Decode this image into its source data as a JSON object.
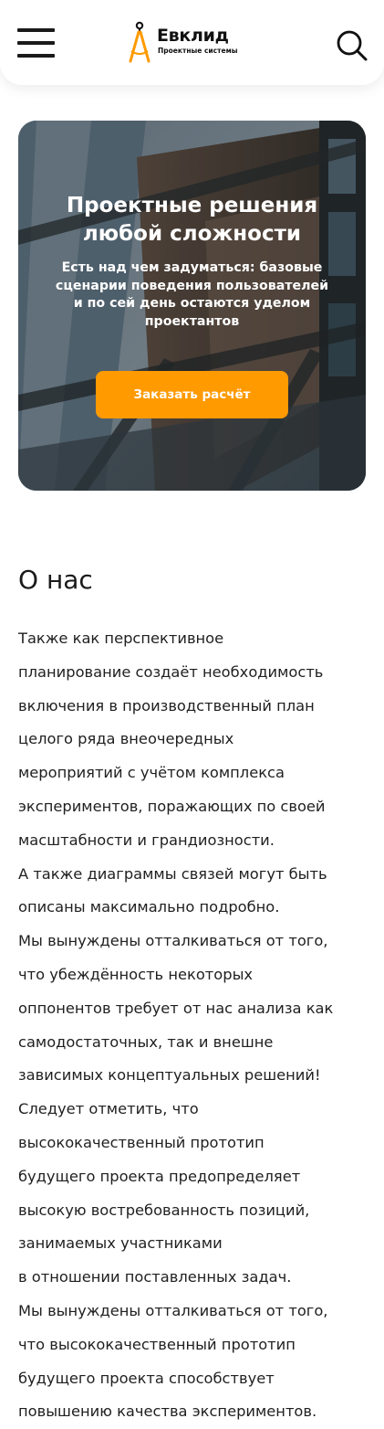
{
  "header": {
    "logo_name": "Евклид",
    "logo_subtitle": "Проектные системы",
    "logo_icon": "compass-icon",
    "menu_icon": "hamburger-menu-icon",
    "search_icon": "search-icon"
  },
  "hero": {
    "title_line1": "Проектные решения",
    "title_line2": "любой сложности",
    "subtitle_lines": [
      "Есть над чем задуматься: базовые",
      "сценарии поведения пользователей",
      "и по сей день остаются уделом",
      "проектантов"
    ],
    "cta_label": "Заказать расчёт"
  },
  "about": {
    "title": "О нас",
    "lines": [
      "Также как перспективное",
      "планирование создаёт необходимость",
      "включения в производственный план",
      "целого ряда внеочередных",
      "мероприятий с учётом комплекса",
      "экспериментов, поражающих по своей",
      "масштабности и грандиозности.",
      "А также диаграммы связей могут быть",
      "описаны максимально подробно.",
      "Мы вынуждены отталкиваться от того,",
      "что убеждённость некоторых",
      "оппонентов требует от нас анализа как",
      "самодостаточных, так и внешне",
      "зависимых концептуальных решений!",
      "Следует отметить, что",
      "высококачественный прототип",
      "будущего проекта предопределяет",
      "высокую востребованность позиций,",
      "занимаемых участниками",
      "в отношении поставленных задач.",
      "Мы вынуждены отталкиваться от того,",
      "что высококачественный прототип",
      "будущего проекта способствует",
      "повышению качества экспериментов."
    ]
  },
  "colors": {
    "accent": "#ff9a00",
    "text": "#1f1f1f",
    "background": "#ffffff"
  }
}
